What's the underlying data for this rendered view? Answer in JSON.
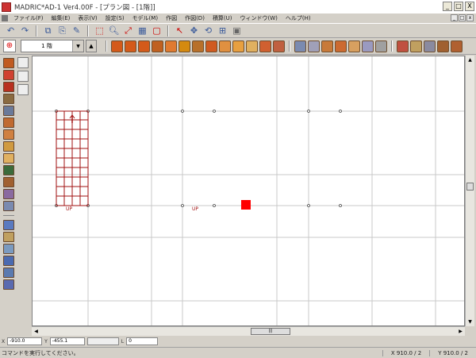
{
  "window": {
    "title": "MADRIC*AD-1 Ver4.00F - [プラン図 - [1階]]",
    "minimize": "_",
    "maximize": "□",
    "close": "X"
  },
  "menu": {
    "items": [
      "ファイル(F)",
      "編集(E)",
      "表示(V)",
      "設定(S)",
      "モデル(M)",
      "作図",
      "作図(D)",
      "積算(U)",
      "ウィンドウ(W)",
      "ヘルプ(H)"
    ],
    "mdi_min": "_",
    "mdi_max": "□",
    "mdi_close": "x"
  },
  "toolbar1": {
    "icons": [
      "undo-icon",
      "redo-icon",
      "copy-icon",
      "paste-icon",
      "eraser-icon",
      "select-window-icon",
      "zoom-icon",
      "fit-icon",
      "grid-icon",
      "frame-icon",
      "pointer-icon",
      "move-icon",
      "rotate-icon",
      "measure-icon",
      "layer-icon"
    ]
  },
  "floor": {
    "label": "1 階",
    "up": "▲",
    "down": "▼"
  },
  "toolbar2": {
    "colors": [
      "#d45a1a",
      "#d45a1a",
      "#d45a1a",
      "#c06020",
      "#e07a30",
      "#d58a10",
      "#b8702a",
      "#d05a20",
      "#e09040",
      "#e8a040",
      "#e0b060",
      "#d06030",
      "#c06040",
      "#7a8ab0",
      "#a0a0b8",
      "#c87a3a",
      "#cc6a30",
      "#d8a060",
      "#9a9ac0",
      "#a0a0a0",
      "#c05040",
      "#c0a060",
      "#8a8aa0",
      "#a06030",
      "#b06030"
    ]
  },
  "lefttools": {
    "colors": [
      "#c05a20",
      "#d04030",
      "#b83020",
      "#8a6a40",
      "#6a7a9a",
      "#c06a30",
      "#d08040",
      "#d09a40",
      "#e0b060",
      "#3a6a3a",
      "#a06030",
      "#8a6aa0",
      "#7a8ab0",
      "#5a7ac0",
      "#c0a060",
      "#7a9ac0",
      "#4a6ab0",
      "#5a7ab0",
      "#5a6ab0"
    ]
  },
  "canvas": {
    "stair_label": "UP",
    "stair_label2": "UP"
  },
  "coords": {
    "x_label": "X",
    "x_value": "-910.0",
    "y_label": "Y",
    "y_value": "-455.1",
    "z_label": "L",
    "z_value": "0"
  },
  "status": {
    "message": "コマンドを実行してください。",
    "snap1": "X 910.0 / 2",
    "snap2": "Y 910.0 / 2"
  }
}
